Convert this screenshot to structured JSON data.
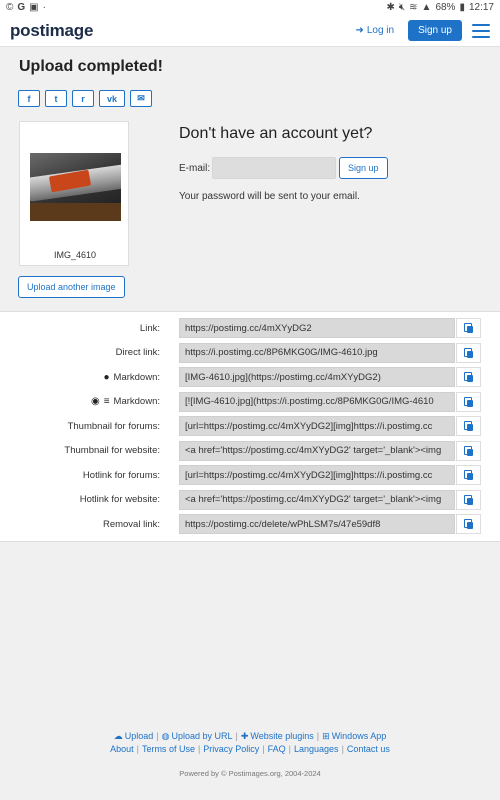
{
  "statusbar": {
    "left_icons": [
      "©",
      "G",
      "▣",
      "·"
    ],
    "battery": "68%",
    "time": "12:17"
  },
  "header": {
    "logo": "postimage",
    "login": "Log in",
    "signup": "Sign up"
  },
  "upload": {
    "title": "Upload completed!",
    "share_icons": [
      "facebook-icon",
      "twitter-icon",
      "reddit-icon",
      "vk-icon",
      "email-icon"
    ],
    "share_glyphs": [
      "f",
      "t",
      "r",
      "vk",
      "✉"
    ],
    "image_name": "IMG_4610",
    "upload_another": "Upload another image"
  },
  "account": {
    "title": "Don't have an account yet?",
    "email_label": "E-mail:",
    "email_value": "",
    "signup_button": "Sign up",
    "password_note": "Your password will be sent to your email."
  },
  "links": [
    {
      "label": "Link:",
      "value": "https://postimg.cc/4mXYyDG2"
    },
    {
      "label": "Direct link:",
      "value": "https://i.postimg.cc/8P6MKG0G/IMG-4610.jpg"
    },
    {
      "label": "Markdown:",
      "value": "[IMG-4610.jpg](https://postimg.cc/4mXYyDG2)",
      "icon": "reddit-icon"
    },
    {
      "label": "Markdown:",
      "value": "[![IMG-4610.jpg](https://i.postimg.cc/8P6MKG0G/IMG-4610",
      "icon": "github-stackoverflow-icons"
    },
    {
      "label": "Thumbnail for forums:",
      "value": "[url=https://postimg.cc/4mXYyDG2][img]https://i.postimg.cc"
    },
    {
      "label": "Thumbnail for website:",
      "value": "<a href='https://postimg.cc/4mXYyDG2' target='_blank'><img"
    },
    {
      "label": "Hotlink for forums:",
      "value": "[url=https://postimg.cc/4mXYyDG2][img]https://i.postimg.cc"
    },
    {
      "label": "Hotlink for website:",
      "value": "<a href='https://postimg.cc/4mXYyDG2' target='_blank'><img"
    },
    {
      "label": "Removal link:",
      "value": "https://postimg.cc/delete/wPhLSM7s/47e59df8"
    }
  ],
  "footer": {
    "row1": [
      "Upload",
      "Upload by URL",
      "Website plugins",
      "Windows App"
    ],
    "row2": [
      "About",
      "Terms of Use",
      "Privacy Policy",
      "FAQ",
      "Languages",
      "Contact us"
    ],
    "powered": "Powered by © Postimages.org, 2004-2024"
  }
}
